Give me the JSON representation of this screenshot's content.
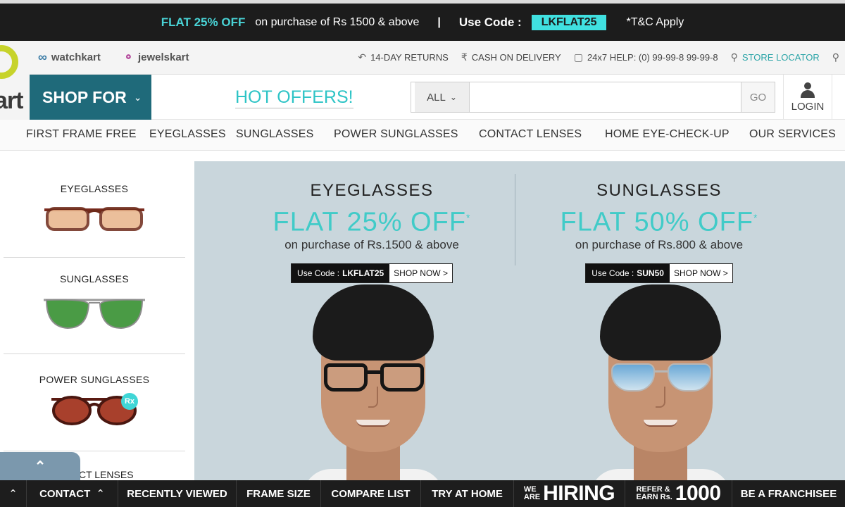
{
  "promo": {
    "highlight": "FLAT 25% OFF",
    "text": "on purchase of Rs 1500 & above",
    "separator": "|",
    "code_label": "Use Code   :",
    "code": "LKFLAT25",
    "terms": "*T&C Apply"
  },
  "logo": {
    "partial_text": "art"
  },
  "brands": [
    {
      "label": "watchkart",
      "icon": "watch-icon"
    },
    {
      "label": "jewelskart",
      "icon": "ring-icon"
    }
  ],
  "utility": {
    "returns": "14-DAY RETURNS",
    "cod": "CASH ON DELIVERY",
    "help": "24x7 HELP: (0) 99-99-8 99-99-8",
    "store": "STORE LOCATOR"
  },
  "shop_for": "SHOP FOR",
  "hot_offers": "HOT OFFERS!",
  "search": {
    "category": "ALL",
    "placeholder": "",
    "go": "GO"
  },
  "login": "LOGIN",
  "nav": [
    "FIRST FRAME FREE",
    "EYEGLASSES",
    "SUNGLASSES",
    "POWER SUNGLASSES",
    "CONTACT LENSES",
    "HOME EYE-CHECK-UP",
    "OUR SERVICES"
  ],
  "sidebar": {
    "categories": [
      "EYEGLASSES",
      "SUNGLASSES",
      "POWER SUNGLASSES"
    ],
    "rx_badge": "Rx",
    "partial_label": "CT LENSES"
  },
  "banner": {
    "left": {
      "heading": "EYEGLASSES",
      "offer": "FLAT 25% OFF",
      "offer_mark": "*",
      "sub": "on purchase of Rs.1500 & above",
      "code_label": "Use Code :",
      "code": "LKFLAT25",
      "cta": "SHOP NOW >"
    },
    "right": {
      "heading": "SUNGLASSES",
      "offer": "FLAT 50% OFF",
      "offer_mark": "*",
      "sub": "on purchase of Rs.800 & above",
      "code_label": "Use Code :",
      "code": "SUN50",
      "cta": "SHOP NOW >"
    }
  },
  "bottom_bar": {
    "contact": "CONTACT",
    "recently_viewed": "RECENTLY VIEWED",
    "frame_size": "FRAME SIZE",
    "compare_list": "COMPARE LIST",
    "try_at_home": "TRY AT HOME",
    "hiring_small_1": "WE",
    "hiring_small_2": "ARE",
    "hiring_big": "HIRING",
    "refer_small_1": "REFER &",
    "refer_small_2": "EARN Rs.",
    "refer_big": "1000",
    "franchise": "BE A FRANCHISEE"
  },
  "colors": {
    "accent_teal": "#41cbc8",
    "shop_for_bg": "#1f6a7a",
    "promo_bg": "#1c1c1c",
    "banner_bg": "#c9d6dc",
    "code_bg": "#40e0e0"
  }
}
